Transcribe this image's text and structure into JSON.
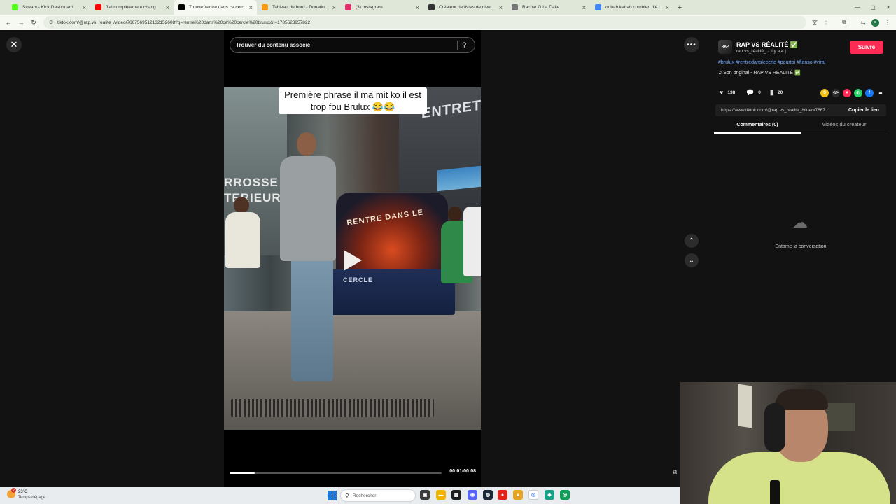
{
  "browser": {
    "tabs": [
      {
        "label": "Stream - Kick Dashboard",
        "favicon_color": "#53fc18",
        "active": false
      },
      {
        "label": "J'ai complètement changé de v",
        "favicon_color": "#ff0000",
        "active": false
      },
      {
        "label": "Trouve 'rentre dans ce cerc",
        "favicon_color": "#000000",
        "active": true
      },
      {
        "label": "Tableau de bord - DonationAle",
        "favicon_color": "#f39c12",
        "active": false
      },
      {
        "label": "(3) Instagram",
        "favicon_color": "#e1306c",
        "active": false
      },
      {
        "label": "Créateur de listes de niveaux p",
        "favicon_color": "#333333",
        "active": false
      },
      {
        "label": "Rachat G La Dalle",
        "favicon_color": "#777777",
        "active": false
      },
      {
        "label": "nobab kebab combien d'établi",
        "favicon_color": "#4285f4",
        "active": false
      }
    ],
    "url": "tiktok.com/@rap.vs_realite_/video/7667569512132152608?q=rentre%20dans%20ce%20cercle%20brulux&t=1785623957822",
    "profile_initial": "E"
  },
  "search": {
    "placeholder": "Trouver du contenu associé"
  },
  "video": {
    "caption": "Première phrase il ma mit ko il est trop fou Brulux 😂😂",
    "scene_signs": {
      "entret": "ENTRETI",
      "rrosse": "RROSSE\nTERIEUR",
      "backdrop": "RENTRE DANS LE",
      "table": "CERCLE"
    },
    "time": "00:01/00:08",
    "progress": 0.12
  },
  "account": {
    "avatar_text": "RAP",
    "name": "RAP VS RÉALITÉ ✅",
    "handle": "rap.vs_réalité_ · Il y a 4 j",
    "follow_label": "Suivre",
    "hashtags": "#brulux #rentredanslecerle #pourtoi #fianso #viral",
    "sound": "♫  Son original - RAP VS RÉALITÉ ✅"
  },
  "stats": {
    "likes": "138",
    "comments": "0",
    "saves": "20"
  },
  "share_icons": [
    {
      "name": "coin-icon",
      "color": "#f2c318",
      "glyph": "$"
    },
    {
      "name": "embed-icon",
      "color": "#2b2b2b",
      "glyph": "</>"
    },
    {
      "name": "repost-icon",
      "color": "#fe2c55",
      "glyph": "▼"
    },
    {
      "name": "whatsapp-icon",
      "color": "#25d366",
      "glyph": "✆"
    },
    {
      "name": "facebook-icon",
      "color": "#1877f2",
      "glyph": "f"
    },
    {
      "name": "share-arrow-icon",
      "color": "#121212",
      "glyph": "➦"
    }
  ],
  "link": {
    "url": "https://www.tiktok.com/@rap.vs_realite_/video/7667...",
    "copy_label": "Copier le lien"
  },
  "comments_tabs": {
    "comments": "Commentaires (0)",
    "creator_videos": "Vidéos du créateur"
  },
  "empty_state": "Entame la conversation",
  "taskbar": {
    "weather_temp": "23°C",
    "weather_desc": "Temps dégagé",
    "weather_badge": "2",
    "search_placeholder": "Rechercher"
  }
}
